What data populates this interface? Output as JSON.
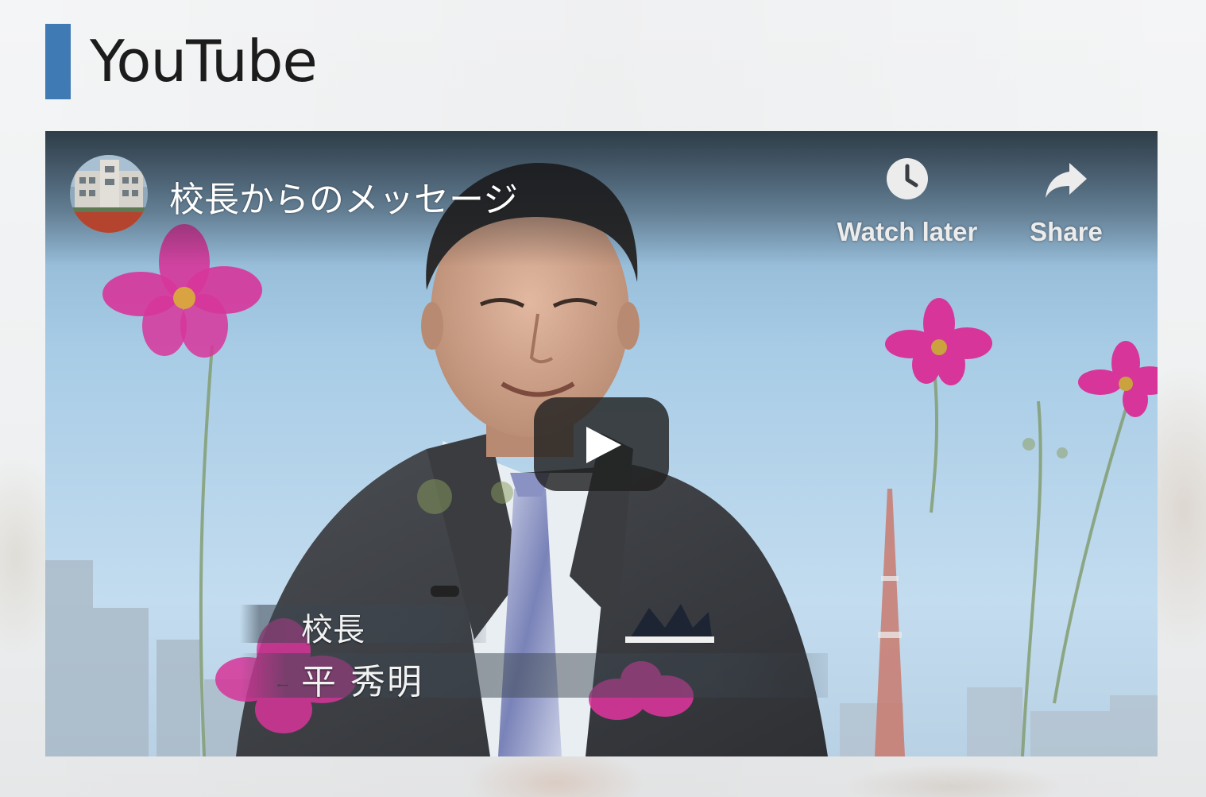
{
  "section": {
    "title": "YouTube"
  },
  "video": {
    "title": "校長からのメッセージ",
    "channel_avatar": "school-building-avatar",
    "actions": {
      "watch_later": {
        "label": "Watch later",
        "icon": "clock-icon"
      },
      "share": {
        "label": "Share",
        "icon": "share-arrow-icon"
      }
    },
    "play_button_icon": "play-icon",
    "caption": {
      "role": "校長",
      "name": "平 秀明"
    }
  },
  "colors": {
    "accent": "#3f7ab5",
    "title_text": "#1c1c1c",
    "play_button": "#212121"
  }
}
